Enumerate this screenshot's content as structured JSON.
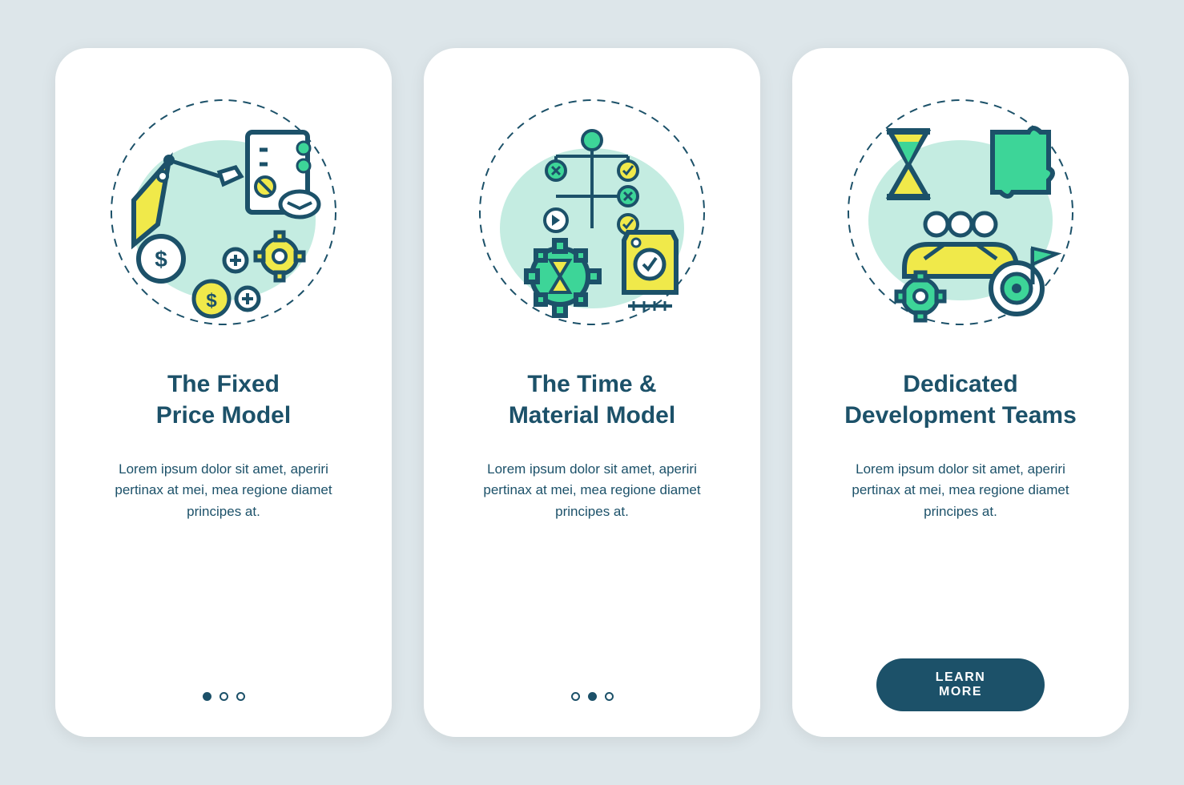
{
  "screens": [
    {
      "title": "The Fixed\nPrice Model",
      "description": "Lorem ipsum dolor sit amet, aperiri pertinax at mei, mea regione diamet principes at.",
      "activeDot": 0,
      "hasCta": false
    },
    {
      "title": "The Time &\nMaterial Model",
      "description": "Lorem ipsum dolor sit amet, aperiri pertinax at mei, mea regione diamet principes at.",
      "activeDot": 1,
      "hasCta": false
    },
    {
      "title": "Dedicated\nDevelopment Teams",
      "description": "Lorem ipsum dolor sit amet, aperiri pertinax at mei, mea regione diamet principes at.",
      "activeDot": null,
      "hasCta": true,
      "ctaLabel": "LEARN MORE"
    }
  ],
  "colors": {
    "primary": "#1c5169",
    "accent": "#3dd598",
    "highlight": "#f0e94a",
    "background": "#dde6ea",
    "card": "#ffffff",
    "softTeal": "#9de0cd"
  }
}
